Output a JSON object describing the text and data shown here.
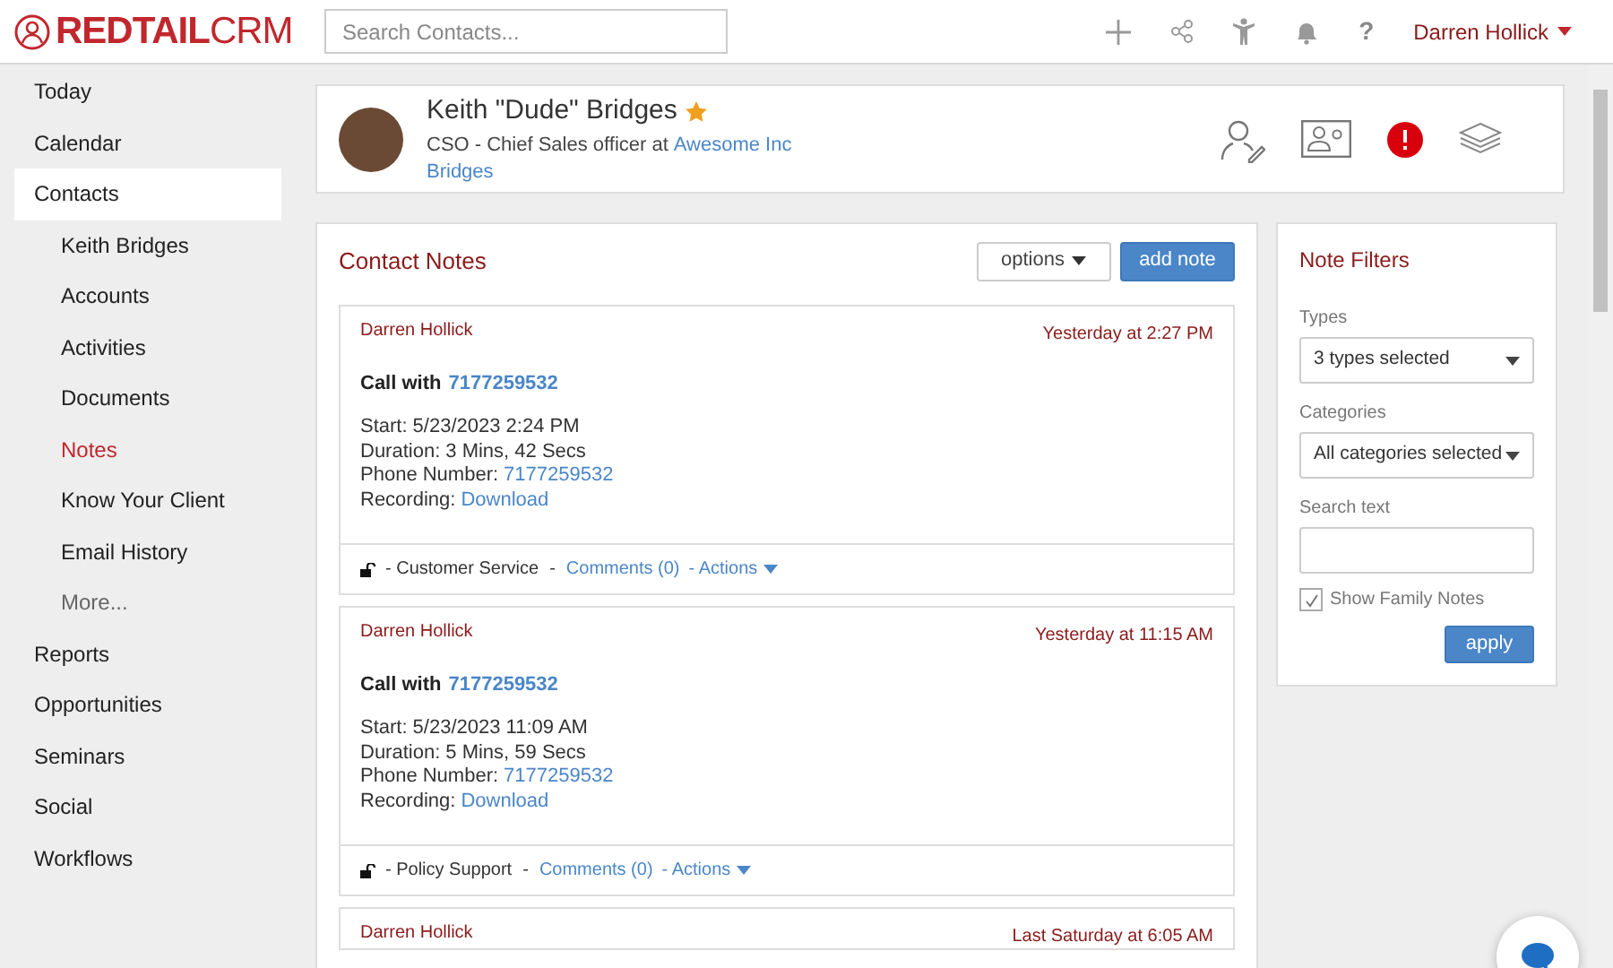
{
  "header": {
    "logo_bold": "REDTAIL",
    "logo_light": "CRM",
    "search": {
      "placeholder": "Search Contacts..."
    },
    "user": "Darren Hollick",
    "help_icon": "?"
  },
  "sidebar": {
    "items": [
      {
        "label": "Today",
        "selected": false
      },
      {
        "label": "Calendar",
        "selected": false
      },
      {
        "label": "Contacts",
        "selected": true,
        "children": [
          {
            "label": "Keith Bridges",
            "selected": false,
            "kind": "link"
          },
          {
            "label": "Accounts",
            "selected": false,
            "kind": "link"
          },
          {
            "label": "Activities",
            "selected": false,
            "kind": "link"
          },
          {
            "label": "Documents",
            "selected": false,
            "kind": "link"
          },
          {
            "label": "Notes",
            "selected": true,
            "kind": "link"
          },
          {
            "label": "Know Your Client",
            "selected": false,
            "kind": "link"
          },
          {
            "label": "Email History",
            "selected": false,
            "kind": "link"
          },
          {
            "label": "More...",
            "selected": false,
            "kind": "more"
          }
        ]
      },
      {
        "label": "Reports",
        "selected": false
      },
      {
        "label": "Opportunities",
        "selected": false
      },
      {
        "label": "Seminars",
        "selected": false
      },
      {
        "label": "Social",
        "selected": false
      },
      {
        "label": "Workflows",
        "selected": false
      }
    ]
  },
  "contact": {
    "name": "Keith \"Dude\" Bridges",
    "favorite": true,
    "title": "CSO - Chief Sales officer at",
    "company": "Awesome Inc",
    "family": "Bridges"
  },
  "notes_panel": {
    "title": "Contact Notes",
    "options_button": "options",
    "add_button": "add note",
    "notes": [
      {
        "author": "Darren Hollick",
        "time": "Yesterday at 2:27 PM",
        "title_label": "Call with",
        "title_link": "7177259532",
        "lines": [
          {
            "label": "Start:",
            "value": "5/23/2023 2:24 PM",
            "kind": "text"
          },
          {
            "label": "Duration:",
            "value": "3 Mins, 42 Secs",
            "kind": "text"
          },
          {
            "label": "Phone Number:",
            "value": "7177259532",
            "kind": "link"
          },
          {
            "label": "Recording:",
            "value": "Download",
            "kind": "link"
          }
        ],
        "category": "- Customer Service",
        "separator": "-",
        "comments": "Comments (0)",
        "actions": "- Actions"
      },
      {
        "author": "Darren Hollick",
        "time": "Yesterday at 11:15 AM",
        "title_label": "Call with",
        "title_link": "7177259532",
        "lines": [
          {
            "label": "Start:",
            "value": "5/23/2023 11:09 AM",
            "kind": "text"
          },
          {
            "label": "Duration:",
            "value": "5 Mins, 59 Secs",
            "kind": "text"
          },
          {
            "label": "Phone Number:",
            "value": "7177259532",
            "kind": "link"
          },
          {
            "label": "Recording:",
            "value": "Download",
            "kind": "link"
          }
        ],
        "category": "- Policy Support",
        "separator": "-",
        "comments": "Comments (0)",
        "actions": "- Actions"
      },
      {
        "author": "Darren Hollick",
        "time": "Last Saturday at 6:05 AM"
      }
    ]
  },
  "filters": {
    "title": "Note Filters",
    "types_label": "Types",
    "types_value": "3 types selected",
    "categories_label": "Categories",
    "categories_value": "All categories selected",
    "search_label": "Search text",
    "family_notes": {
      "label": "Show Family Notes",
      "checked": true
    },
    "apply_button": "apply"
  }
}
